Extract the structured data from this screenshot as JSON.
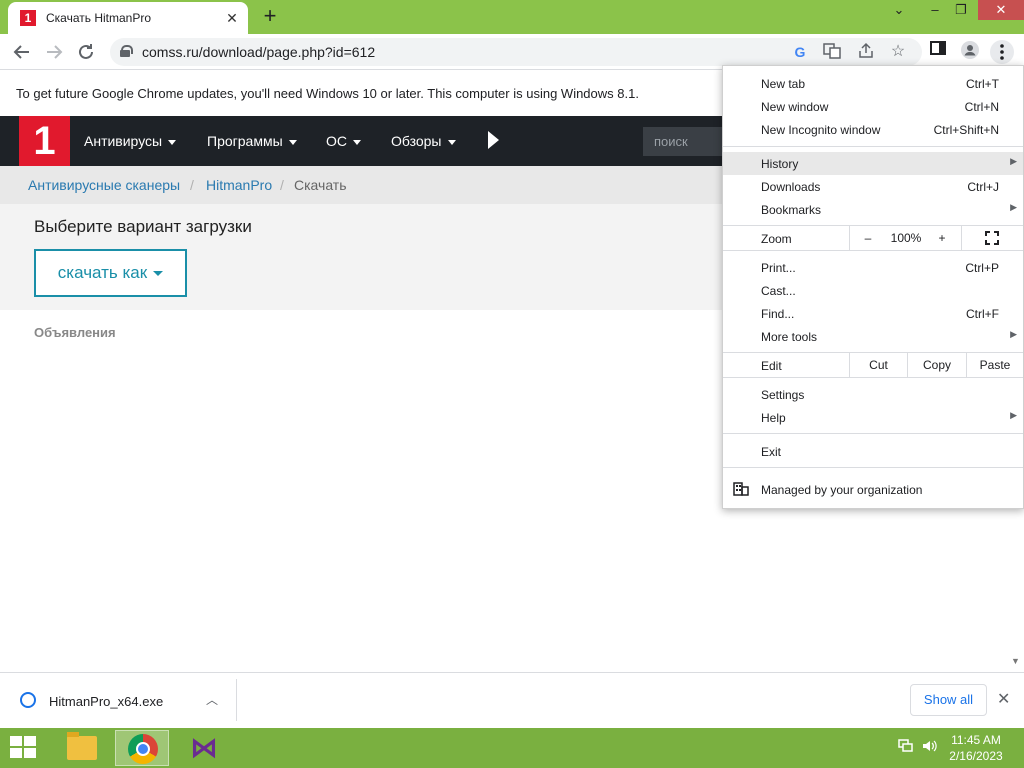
{
  "browser": {
    "tab_title": "Скачать HitmanPro",
    "tab_favicon_text": "1",
    "new_tab_label": "+",
    "tab_close": "✕",
    "window_controls": {
      "dropdown": "⌄",
      "minimize": "–",
      "restore": "❐",
      "close": "✕"
    },
    "url": "comss.ru/download/page.php?id=612",
    "infobar_text": "To get future Google Chrome updates, you'll need Windows 10 or later. This computer is using Windows 8.1."
  },
  "site": {
    "logo_text": "1",
    "nav": [
      {
        "label": "Антивирусы"
      },
      {
        "label": "Программы"
      },
      {
        "label": "ОС"
      },
      {
        "label": "Обзоры"
      }
    ],
    "search_placeholder": "поиск",
    "breadcrumb": {
      "items": [
        "Антивирусные сканеры",
        "HitmanPro"
      ],
      "current": "Скачать",
      "sep": "/"
    },
    "download_heading": "Выберите вариант загрузки",
    "download_button": "скачать как",
    "ads_label": "Объявления"
  },
  "menu": {
    "new_tab": {
      "label": "New tab",
      "shortcut": "Ctrl+T"
    },
    "new_window": {
      "label": "New window",
      "shortcut": "Ctrl+N"
    },
    "new_incognito": {
      "label": "New Incognito window",
      "shortcut": "Ctrl+Shift+N"
    },
    "history": {
      "label": "History"
    },
    "downloads": {
      "label": "Downloads",
      "shortcut": "Ctrl+J"
    },
    "bookmarks": {
      "label": "Bookmarks"
    },
    "zoom": {
      "label": "Zoom",
      "minus": "–",
      "value": "100%",
      "plus": "+"
    },
    "print": {
      "label": "Print...",
      "shortcut": "Ctrl+P"
    },
    "cast": {
      "label": "Cast..."
    },
    "find": {
      "label": "Find...",
      "shortcut": "Ctrl+F"
    },
    "more_tools": {
      "label": "More tools"
    },
    "edit": {
      "label": "Edit",
      "cut": "Cut",
      "copy": "Copy",
      "paste": "Paste"
    },
    "settings": {
      "label": "Settings"
    },
    "help": {
      "label": "Help"
    },
    "exit": {
      "label": "Exit"
    },
    "managed": {
      "label": "Managed by your organization"
    },
    "submenu_arrow": "▶"
  },
  "download_bar": {
    "filename": "HitmanPro_x64.exe",
    "chevron": "︿",
    "show_all": "Show all",
    "close": "✕"
  },
  "taskbar": {
    "time": "11:45 AM",
    "date": "2/16/2023",
    "vs_glyph": "⋈"
  },
  "icons": {
    "back": "back-arrow-icon",
    "forward": "forward-arrow-icon",
    "reload": "reload-icon",
    "google": "google-icon",
    "translate": "translate-icon",
    "share": "share-icon",
    "bookmark_star": "star-icon",
    "side_panel": "side-panel-icon",
    "profile": "profile-icon",
    "menu": "kebab-menu-icon"
  },
  "colors": {
    "tabstrip": "#8bc34a",
    "site_nav": "#1e2227",
    "brand_red": "#e1192d",
    "accent_teal": "#1a8fa8",
    "taskbar": "#7ab040"
  }
}
